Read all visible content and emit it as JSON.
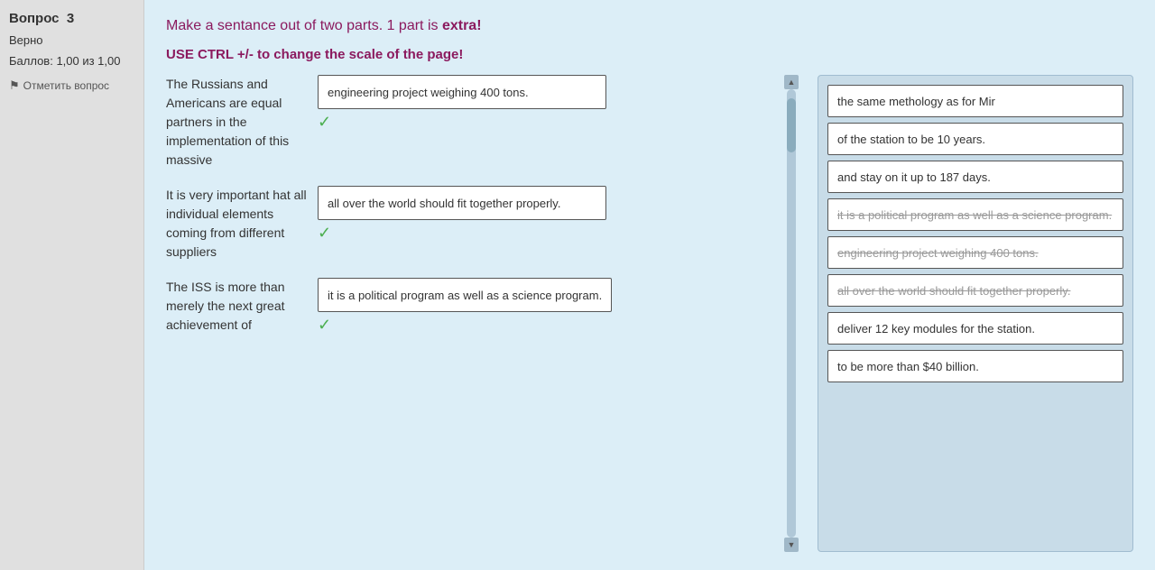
{
  "sidebar": {
    "question_label": "Вопрос",
    "question_number": "3",
    "correct_label": "Верно",
    "score_label": "Баллов: 1,00 из 1,00",
    "flag_label": "Отметить вопрос"
  },
  "header": {
    "instruction1_prefix": "Make a sentance out of two parts. 1 part is ",
    "instruction1_extra": "extra!",
    "instruction2": "USE CTRL +/- to change the scale of the page!"
  },
  "sentences": [
    {
      "id": "s1",
      "text": "The Russians and Americans are equal partners in the implementation of this massive",
      "drop_text": "engineering project weighing 400 tons.",
      "strikethrough": false,
      "checked": true
    },
    {
      "id": "s2",
      "text": "It is very important hat all individual elements coming from different suppliers",
      "drop_text": "all over the world should fit together properly.",
      "strikethrough": false,
      "checked": true
    },
    {
      "id": "s3",
      "text": "The ISS is more than merely the next great achievement of",
      "drop_text": "it is a political program as well as a science program.",
      "strikethrough": false,
      "checked": true
    }
  ],
  "answer_bank": {
    "items": [
      {
        "id": "a1",
        "text": "the same methology as for Mir",
        "strikethrough": false
      },
      {
        "id": "a2",
        "text": "of the station to be 10 years.",
        "strikethrough": false
      },
      {
        "id": "a3",
        "text": "and stay on it up to 187 days.",
        "strikethrough": false
      },
      {
        "id": "a4",
        "text": "it is a political program as well as a science program.",
        "strikethrough": true
      },
      {
        "id": "a5",
        "text": "engineering project weighing 400 tons.",
        "strikethrough": true
      },
      {
        "id": "a6",
        "text": "all over the world should fit together properly.",
        "strikethrough": true
      },
      {
        "id": "a7",
        "text": "deliver 12 key modules for the station.",
        "strikethrough": false
      },
      {
        "id": "a8",
        "text": "to be more than $40 billion.",
        "strikethrough": false
      }
    ]
  }
}
